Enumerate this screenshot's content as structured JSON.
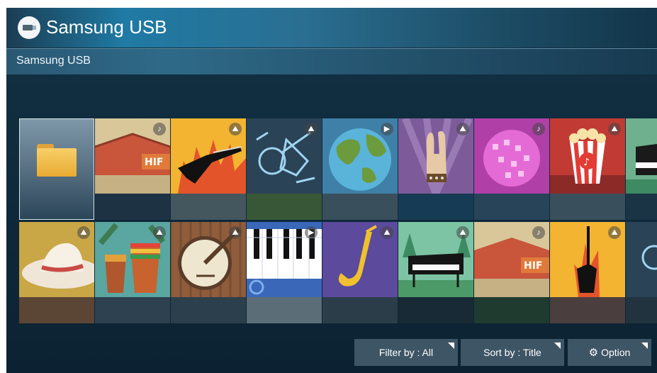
{
  "header": {
    "title": "Samsung USB",
    "icon": "usb-drive-icon"
  },
  "breadcrumb": {
    "label": "Samsung USB"
  },
  "tiles_row1": [
    {
      "kind": "folder",
      "icon": "folder-icon"
    },
    {
      "kind": "music",
      "badge": "♪",
      "badge_icon": "music-note-icon",
      "scene": "stage-tent"
    },
    {
      "kind": "photo",
      "badge": "⛰",
      "badge_icon": "photo-icon",
      "scene": "electric-guitar-flames"
    },
    {
      "kind": "photo",
      "badge": "⛰",
      "badge_icon": "photo-icon",
      "scene": "instrument-outlines"
    },
    {
      "kind": "video",
      "badge": "▶",
      "badge_icon": "play-icon",
      "scene": "globe"
    },
    {
      "kind": "photo",
      "badge": "⛰",
      "badge_icon": "photo-icon",
      "scene": "rock-hand"
    },
    {
      "kind": "music",
      "badge": "♪",
      "badge_icon": "music-note-icon",
      "scene": "disco-ball"
    },
    {
      "kind": "photo",
      "badge": "⛰",
      "badge_icon": "photo-icon",
      "scene": "popcorn"
    },
    {
      "kind": "photo",
      "badge": "⛰",
      "badge_icon": "photo-icon",
      "scene": "piano-forest"
    }
  ],
  "tiles_row2": [
    {
      "kind": "photo",
      "badge": "⛰",
      "badge_icon": "photo-icon",
      "scene": "straw-hat"
    },
    {
      "kind": "photo",
      "badge": "⛰",
      "badge_icon": "photo-icon",
      "scene": "conga-drums"
    },
    {
      "kind": "photo",
      "badge": "⛰",
      "badge_icon": "photo-icon",
      "scene": "banjo"
    },
    {
      "kind": "video",
      "badge": "▶",
      "badge_icon": "play-icon",
      "scene": "keyboard"
    },
    {
      "kind": "photo",
      "badge": "⛰",
      "badge_icon": "photo-icon",
      "scene": "saxophone"
    },
    {
      "kind": "photo",
      "badge": "⛰",
      "badge_icon": "photo-icon",
      "scene": "piano-forest"
    },
    {
      "kind": "music",
      "badge": "♪",
      "badge_icon": "music-note-icon",
      "scene": "stage-tent"
    },
    {
      "kind": "photo",
      "badge": "⛰",
      "badge_icon": "photo-icon",
      "scene": "electric-guitar-flames"
    },
    {
      "kind": "photo",
      "badge": "⛰",
      "badge_icon": "photo-icon",
      "scene": "instrument-outlines"
    }
  ],
  "toolbar": {
    "filter_label": "Filter by : All",
    "sort_label": "Sort by : Title",
    "option_label": "Option",
    "option_icon": "gear-icon"
  },
  "colors": {
    "background": "#0f2a3b",
    "title_bar_accent": "#1f7aa4",
    "button_bg": "#3e5566",
    "focus_border": "#d8e4ea"
  }
}
